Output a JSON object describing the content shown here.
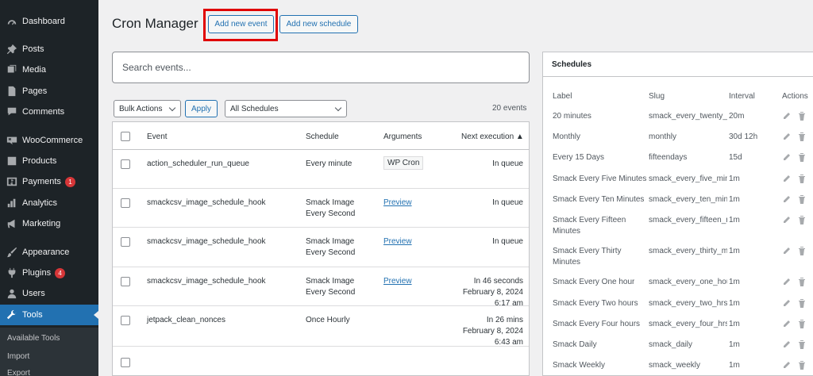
{
  "sidebar": {
    "items": [
      {
        "label": "Dashboard",
        "icon": "dashboard-icon"
      },
      {
        "label": "Posts",
        "icon": "pin-icon"
      },
      {
        "label": "Media",
        "icon": "media-icon"
      },
      {
        "label": "Pages",
        "icon": "pages-icon"
      },
      {
        "label": "Comments",
        "icon": "comment-icon"
      },
      {
        "label": "WooCommerce",
        "icon": "woo-icon"
      },
      {
        "label": "Products",
        "icon": "products-icon"
      },
      {
        "label": "Payments",
        "icon": "payments-icon",
        "badge": "1"
      },
      {
        "label": "Analytics",
        "icon": "analytics-icon"
      },
      {
        "label": "Marketing",
        "icon": "megaphone-icon"
      },
      {
        "label": "Appearance",
        "icon": "brush-icon"
      },
      {
        "label": "Plugins",
        "icon": "plug-icon",
        "badge": "4"
      },
      {
        "label": "Users",
        "icon": "users-icon"
      },
      {
        "label": "Tools",
        "icon": "wrench-icon",
        "active": true
      }
    ],
    "submenu": [
      "Available Tools",
      "Import",
      "Export"
    ]
  },
  "header": {
    "title": "Cron Manager",
    "add_event": "Add new event",
    "add_schedule": "Add new schedule"
  },
  "search": {
    "placeholder": "Search events..."
  },
  "filters": {
    "bulk_actions": "Bulk Actions",
    "apply": "Apply",
    "schedule_filter": "All Schedules",
    "count": "20 events"
  },
  "events_table": {
    "columns": {
      "event": "Event",
      "schedule": "Schedule",
      "arguments": "Arguments",
      "next": "Next execution ▲"
    },
    "rows": [
      {
        "event": "action_scheduler_run_queue",
        "schedule": [
          "Every minute"
        ],
        "arguments": "WP Cron",
        "arg_type": "tag",
        "next": [
          "In queue"
        ]
      },
      {
        "event": "smackcsv_image_schedule_hook",
        "schedule": [
          "Smack Image",
          "Every Second"
        ],
        "arguments": "Preview",
        "arg_type": "link",
        "next": [
          "In queue"
        ]
      },
      {
        "event": "smackcsv_image_schedule_hook",
        "schedule": [
          "Smack Image",
          "Every Second"
        ],
        "arguments": "Preview",
        "arg_type": "link",
        "next": [
          "In queue"
        ]
      },
      {
        "event": "smackcsv_image_schedule_hook",
        "schedule": [
          "Smack Image",
          "Every Second"
        ],
        "arguments": "Preview",
        "arg_type": "link",
        "next": [
          "In 46 seconds",
          "February 8, 2024",
          "6:17 am"
        ]
      },
      {
        "event": "jetpack_clean_nonces",
        "schedule": [
          "Once Hourly"
        ],
        "arguments": "",
        "arg_type": "none",
        "next": [
          "In 26 mins",
          "February 8, 2024",
          "6:43 am"
        ]
      }
    ]
  },
  "schedules": {
    "title": "Schedules",
    "columns": {
      "label": "Label",
      "slug": "Slug",
      "interval": "Interval",
      "actions": "Actions"
    },
    "rows": [
      {
        "label": [
          "20 minutes"
        ],
        "slug": "smack_every_twenty_mi",
        "interval": "20m"
      },
      {
        "label": [
          "Monthly"
        ],
        "slug": "monthly",
        "interval": "30d 12h"
      },
      {
        "label": [
          "Every 15 Days"
        ],
        "slug": "fifteendays",
        "interval": "15d"
      },
      {
        "label": [
          "Smack Every Five Minutes"
        ],
        "slug": "smack_every_five_minu",
        "interval": "1m"
      },
      {
        "label": [
          "Smack Every Ten Minutes"
        ],
        "slug": "smack_every_ten_minu",
        "interval": "1m"
      },
      {
        "label": [
          "Smack Every Fifteen",
          "Minutes"
        ],
        "slug": "smack_every_fifteen_r",
        "interval": "1m"
      },
      {
        "label": [
          "Smack Every Thirty",
          "Minutes"
        ],
        "slug": "smack_every_thirty_mi",
        "interval": "1m"
      },
      {
        "label": [
          "Smack Every One hour"
        ],
        "slug": "smack_every_one_hour",
        "interval": "1m"
      },
      {
        "label": [
          "Smack Every Two hours"
        ],
        "slug": "smack_every_two_hrs",
        "interval": "1m"
      },
      {
        "label": [
          "Smack Every Four hours"
        ],
        "slug": "smack_every_four_hrs",
        "interval": "1m"
      },
      {
        "label": [
          "Smack Daily"
        ],
        "slug": "smack_daily",
        "interval": "1m"
      },
      {
        "label": [
          "Smack Weekly"
        ],
        "slug": "smack_weekly",
        "interval": "1m"
      }
    ]
  },
  "colors": {
    "sidebar_bg": "#1d2327",
    "active_bg": "#2271b1",
    "accent": "#2271b1",
    "highlight": "#e00000",
    "badge": "#d63638"
  }
}
